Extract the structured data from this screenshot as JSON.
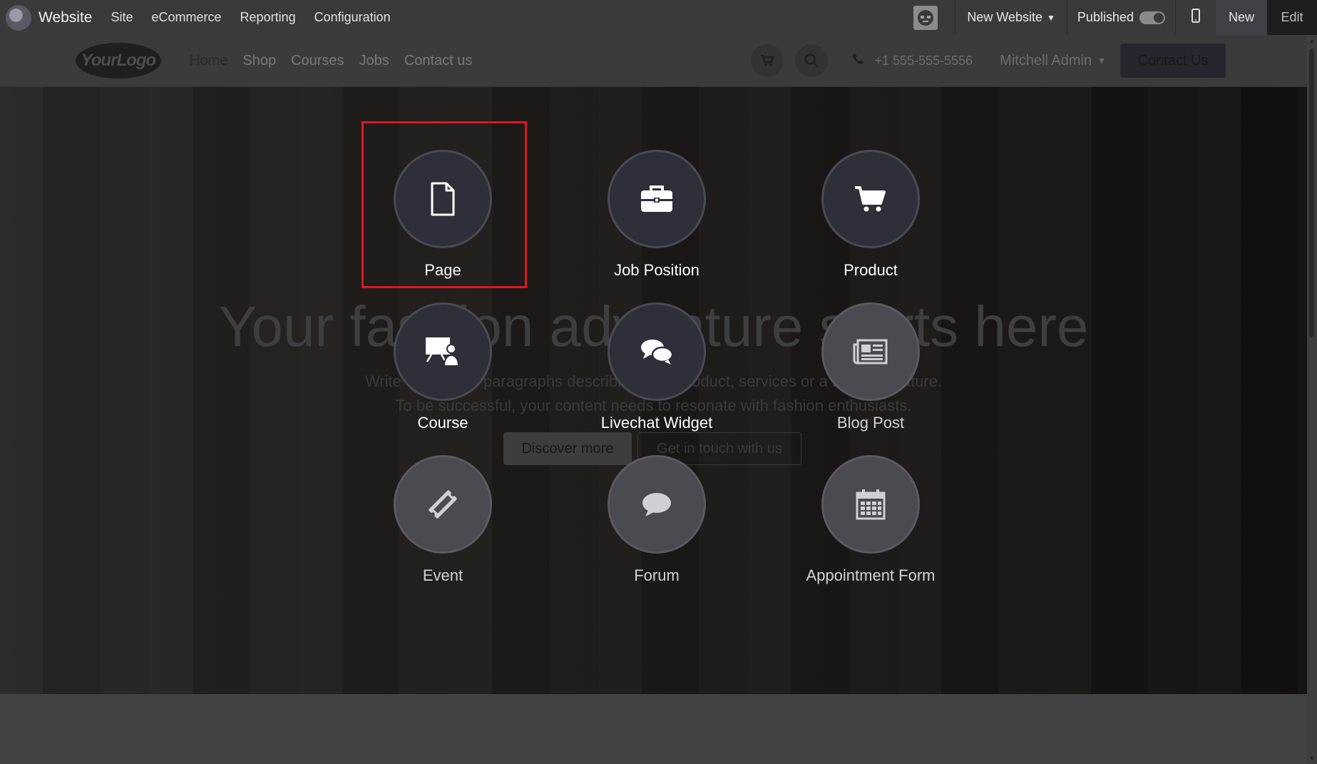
{
  "topbar": {
    "app_name": "Website",
    "menu": [
      "Site",
      "eCommerce",
      "Reporting",
      "Configuration"
    ],
    "new_website_label": "New Website",
    "published_label": "Published",
    "new_label": "New",
    "edit_label": "Edit"
  },
  "site_header": {
    "logo_text": "YourLogo",
    "nav": [
      "Home",
      "Shop",
      "Courses",
      "Jobs",
      "Contact us"
    ],
    "phone": "+1 555-555-5556",
    "user": "Mitchell Admin",
    "contact_button": "Contact Us"
  },
  "hero": {
    "title": "Your fashion adventure starts here",
    "subtitle_line1": "Write one or two paragraphs describing your product, services or a specific feature.",
    "subtitle_line2": "To be successful, your content needs to resonate with fashion enthusiasts.",
    "discover_button": "Discover more",
    "touch_button": "Get in touch with us"
  },
  "picker": {
    "items": [
      {
        "label": "Page",
        "icon": "file-icon",
        "enabled": true
      },
      {
        "label": "Job Position",
        "icon": "briefcase-icon",
        "enabled": true
      },
      {
        "label": "Product",
        "icon": "cart-icon",
        "enabled": true
      },
      {
        "label": "Course",
        "icon": "presentation-icon",
        "enabled": true
      },
      {
        "label": "Livechat Widget",
        "icon": "chat-bubbles-icon",
        "enabled": true
      },
      {
        "label": "Blog Post",
        "icon": "newspaper-icon",
        "enabled": false
      },
      {
        "label": "Event",
        "icon": "ticket-icon",
        "enabled": false
      },
      {
        "label": "Forum",
        "icon": "comment-icon",
        "enabled": false
      },
      {
        "label": "Appointment Form",
        "icon": "calendar-icon",
        "enabled": false
      }
    ]
  },
  "colors": {
    "highlight": "#e0161f",
    "picker_circle": "#2f2f3a",
    "topbar": "#3a3a3a"
  }
}
